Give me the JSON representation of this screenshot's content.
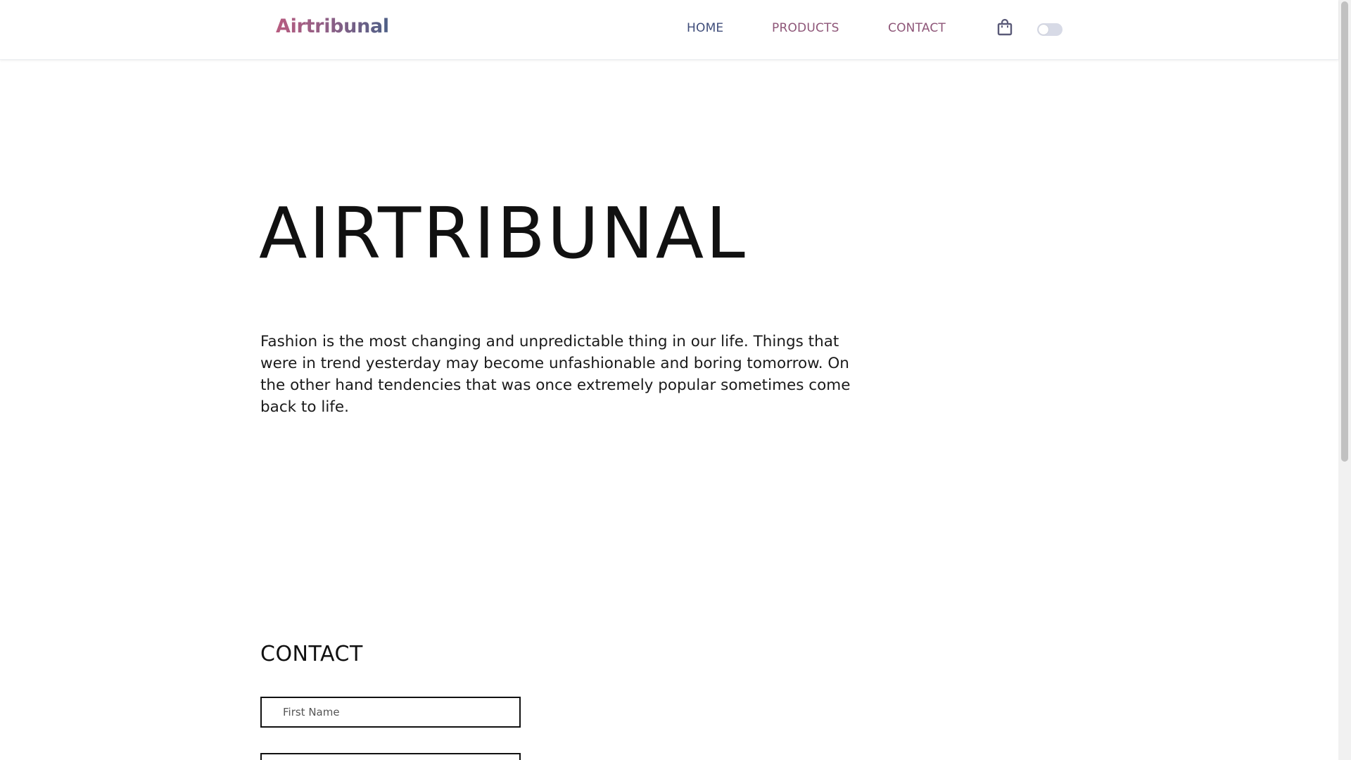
{
  "navbar": {
    "brand": "Airtribunal",
    "links": [
      {
        "label": "HOME"
      },
      {
        "label": "PRODUCTS"
      },
      {
        "label": "CONTACT"
      }
    ],
    "cart_icon": "shopping-bag-icon",
    "theme_toggle": {
      "state": "off"
    }
  },
  "hero": {
    "title": "AIRTRIBUNAL",
    "text": "Fashion is the most changing and unpredictable thing in our life. Things that were in trend yesterday may become unfashionable and boring tomorrow. On the other hand tendencies that was once extremely popular sometimes come back to life."
  },
  "contact": {
    "title": "CONTACT",
    "first_name_placeholder": "First Name",
    "second_placeholder": ""
  },
  "colors": {
    "brand_gradient_start": "#b85c80",
    "brand_gradient_end": "#4d5f86",
    "nav_home": "#3f4d7a",
    "nav_other": "#8e5678",
    "toggle_track": "#d7dae6"
  }
}
